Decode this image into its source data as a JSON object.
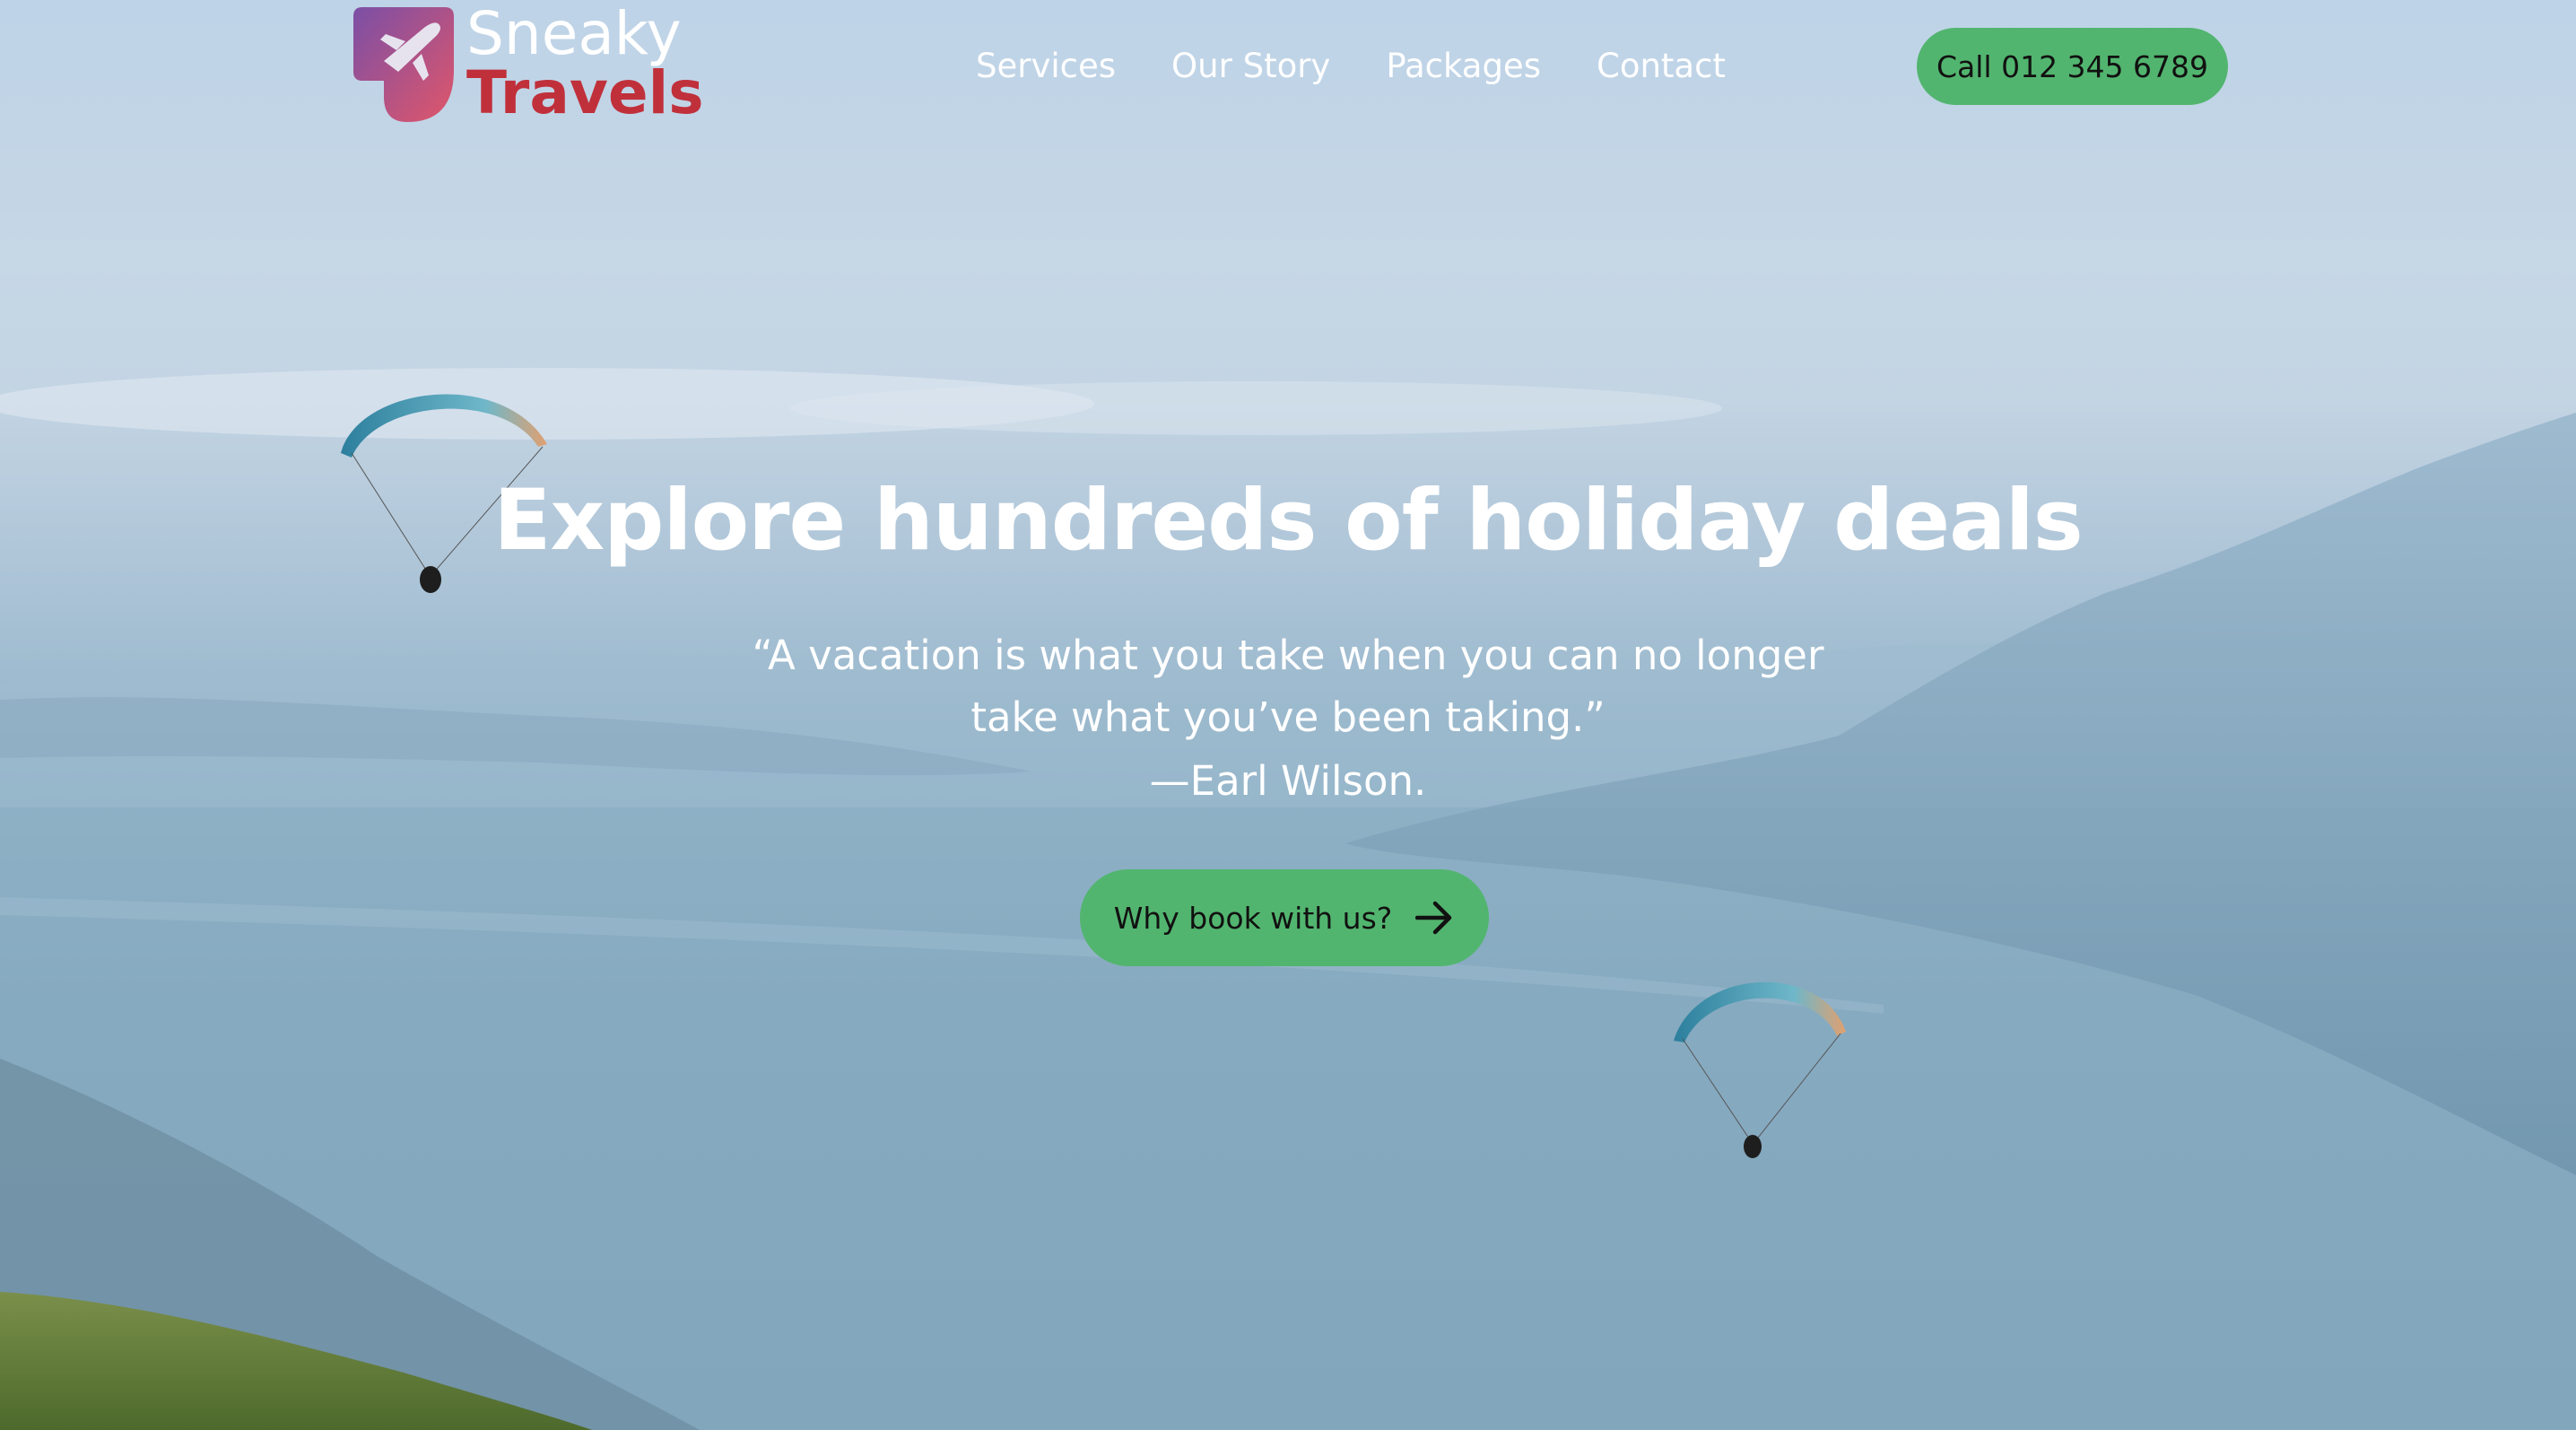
{
  "brand": {
    "name_line1": "Sneaky",
    "name_line2": "Travels",
    "logo_icon": "airplane-icon",
    "logo_gradient": [
      "#7b4fa6",
      "#e0566a"
    ],
    "accent_color": "#c0303b"
  },
  "nav": {
    "items": [
      {
        "label": "Services"
      },
      {
        "label": "Our Story"
      },
      {
        "label": "Packages"
      },
      {
        "label": "Contact"
      }
    ]
  },
  "header": {
    "call_button_label": "Call 012 345 6789",
    "button_color": "#52b56f"
  },
  "hero": {
    "headline": "Explore hundreds of holiday deals",
    "quote": "“A vacation is what you take when you can no longer take what you’ve been taking.”",
    "author": "—Earl Wilson.",
    "cta_label": "Why book with us?",
    "cta_icon": "arrow-right-icon"
  }
}
